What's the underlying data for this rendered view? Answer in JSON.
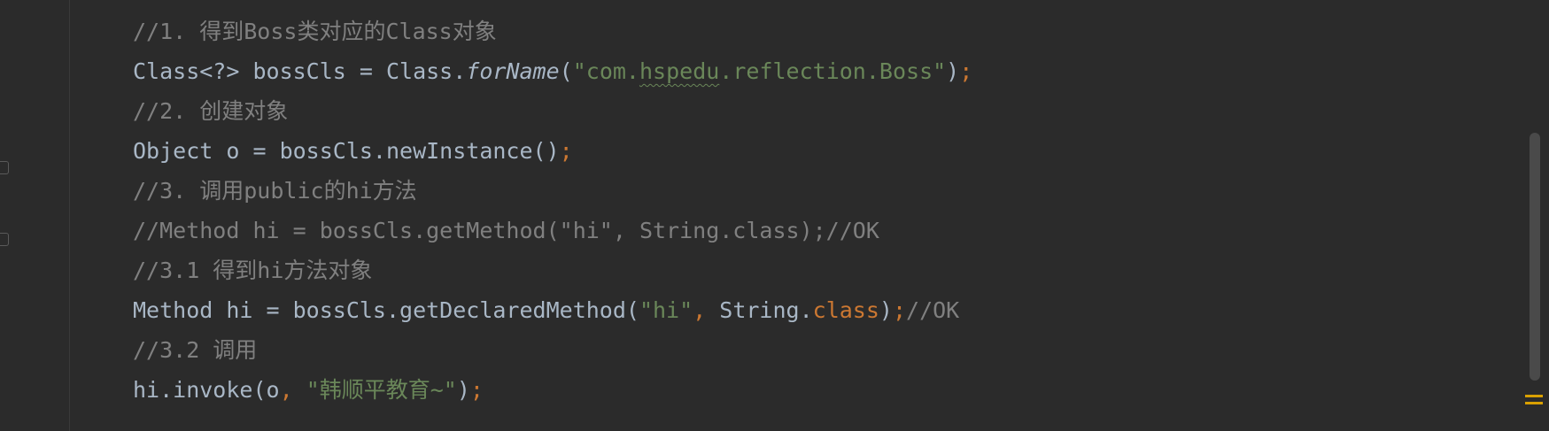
{
  "editor": {
    "lines": [
      {
        "segments": [
          {
            "text": "//1. 得到Boss类对应的Class对象",
            "cls": "comment"
          }
        ]
      },
      {
        "segments": [
          {
            "text": "Class<?> bossCls = Class.",
            "cls": "plain"
          },
          {
            "text": "forName",
            "cls": "plain italic"
          },
          {
            "text": "(",
            "cls": "plain"
          },
          {
            "text": "\"com.",
            "cls": "string"
          },
          {
            "text": "hspedu",
            "cls": "string squiggle"
          },
          {
            "text": ".reflection.Boss\"",
            "cls": "string"
          },
          {
            "text": ")",
            "cls": "plain"
          },
          {
            "text": ";",
            "cls": "keyword"
          }
        ]
      },
      {
        "segments": [
          {
            "text": "//2. 创建对象",
            "cls": "comment"
          }
        ]
      },
      {
        "segments": [
          {
            "text": "Object o = bossCls.newInstance()",
            "cls": "plain"
          },
          {
            "text": ";",
            "cls": "keyword"
          }
        ]
      },
      {
        "segments": [
          {
            "text": "//3. 调用public的hi方法",
            "cls": "comment"
          }
        ]
      },
      {
        "segments": [
          {
            "text": "//Method hi = bossCls.getMethod(\"hi\", String.class);//OK",
            "cls": "comment"
          }
        ]
      },
      {
        "segments": [
          {
            "text": "//3.1 得到hi方法对象",
            "cls": "comment"
          }
        ]
      },
      {
        "segments": [
          {
            "text": "Method hi = bossCls.getDeclaredMethod(",
            "cls": "plain"
          },
          {
            "text": "\"hi\"",
            "cls": "string"
          },
          {
            "text": ", ",
            "cls": "keyword"
          },
          {
            "text": "String.",
            "cls": "plain"
          },
          {
            "text": "class",
            "cls": "keyword"
          },
          {
            "text": ")",
            "cls": "plain"
          },
          {
            "text": ";",
            "cls": "keyword"
          },
          {
            "text": "//OK",
            "cls": "comment"
          }
        ]
      },
      {
        "segments": [
          {
            "text": "//3.2 调用",
            "cls": "comment"
          }
        ]
      },
      {
        "segments": [
          {
            "text": "hi.invoke(o",
            "cls": "plain"
          },
          {
            "text": ", ",
            "cls": "keyword"
          },
          {
            "text": "\"韩顺平教育~\"",
            "cls": "string"
          },
          {
            "text": ")",
            "cls": "plain"
          },
          {
            "text": ";",
            "cls": "keyword"
          }
        ]
      }
    ]
  },
  "theme": {
    "background": "#2b2b2b",
    "text": "#a9b7c6",
    "comment": "#808080",
    "string": "#6a8759",
    "keyword": "#cc7832",
    "marker": "#d9a000"
  },
  "icons": {
    "fold_markers": [
      "fold-marker-icon",
      "fold-marker-icon"
    ],
    "status_marker": "warning-stripes-icon"
  }
}
